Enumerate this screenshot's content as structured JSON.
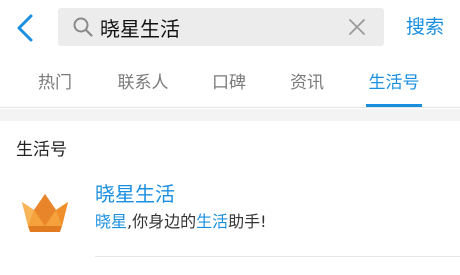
{
  "search": {
    "query": "晓星生活",
    "button_label": "搜索"
  },
  "tabs": [
    {
      "label": "热门"
    },
    {
      "label": "联系人"
    },
    {
      "label": "口碑"
    },
    {
      "label": "资讯"
    },
    {
      "label": "生活号",
      "active": true
    }
  ],
  "section": {
    "title": "生活号"
  },
  "result": {
    "title": "晓星生活",
    "description": {
      "part1": "晓星",
      "part2": ",你身边的",
      "part3": "生活",
      "part4": "助手!"
    }
  },
  "colors": {
    "accent": "#1a8fe0",
    "logo_orange": "#f0952a"
  }
}
